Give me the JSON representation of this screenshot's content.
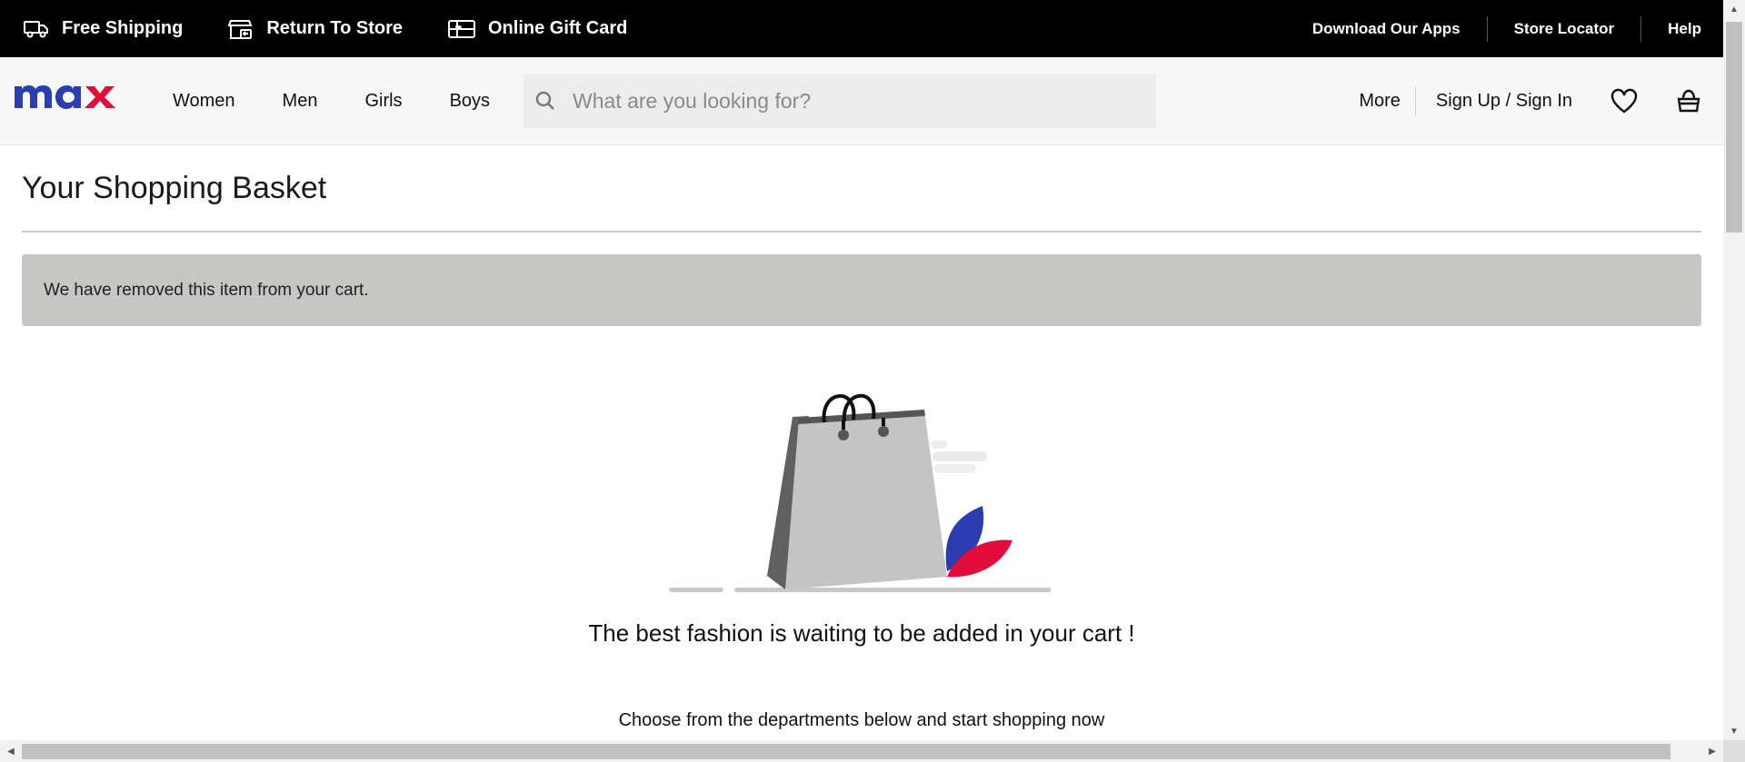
{
  "utility_bar": {
    "items": [
      {
        "label": "Free Shipping",
        "icon": "truck-icon"
      },
      {
        "label": "Return To Store",
        "icon": "store-return-icon"
      },
      {
        "label": "Online Gift Card",
        "icon": "gift-card-icon"
      }
    ],
    "links": [
      "Download Our Apps",
      "Store Locator",
      "Help"
    ]
  },
  "header": {
    "logo_text": "max",
    "nav": [
      "Women",
      "Men",
      "Girls",
      "Boys"
    ],
    "search_placeholder": "What are you looking for?",
    "more_label": "More",
    "signin_label": "Sign Up / Sign In",
    "wishlist_icon": "heart-icon",
    "basket_icon": "basket-icon"
  },
  "basket": {
    "title": "Your Shopping Basket",
    "notice": "We have removed this item from your cart.",
    "empty_title": "The best fashion is waiting to be added in your cart !",
    "empty_subtitle": "Choose from the departments below and start shopping now"
  },
  "colors": {
    "brand_blue": "#2a3db1",
    "brand_red": "#e30b39",
    "notice_bg": "#c6c6c5"
  }
}
